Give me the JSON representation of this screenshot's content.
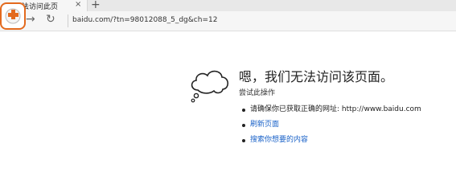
{
  "browser": {
    "tab_title": "无法访问此页",
    "tab_close": "×",
    "new_tab": "+",
    "back": "←",
    "forward": "→",
    "refresh": "↻",
    "address": "baidu.com/?tn=98012088_5_dg&ch=12"
  },
  "error": {
    "title": "嗯，我们无法访问该页面。",
    "subtitle": "尝试此操作",
    "suggestions": [
      {
        "text": "请确保你已获取正确的网址: http://www.baidu.com",
        "link": false
      },
      {
        "text": "刷新页面",
        "link": true
      },
      {
        "text": "搜索你想要的内容",
        "link": true
      }
    ]
  },
  "colors": {
    "logo_accent": "#e36a1e",
    "link": "#1a62c8"
  },
  "icons": [
    "logo-badge-icon",
    "cloud-icon",
    "tab-page-icon"
  ]
}
